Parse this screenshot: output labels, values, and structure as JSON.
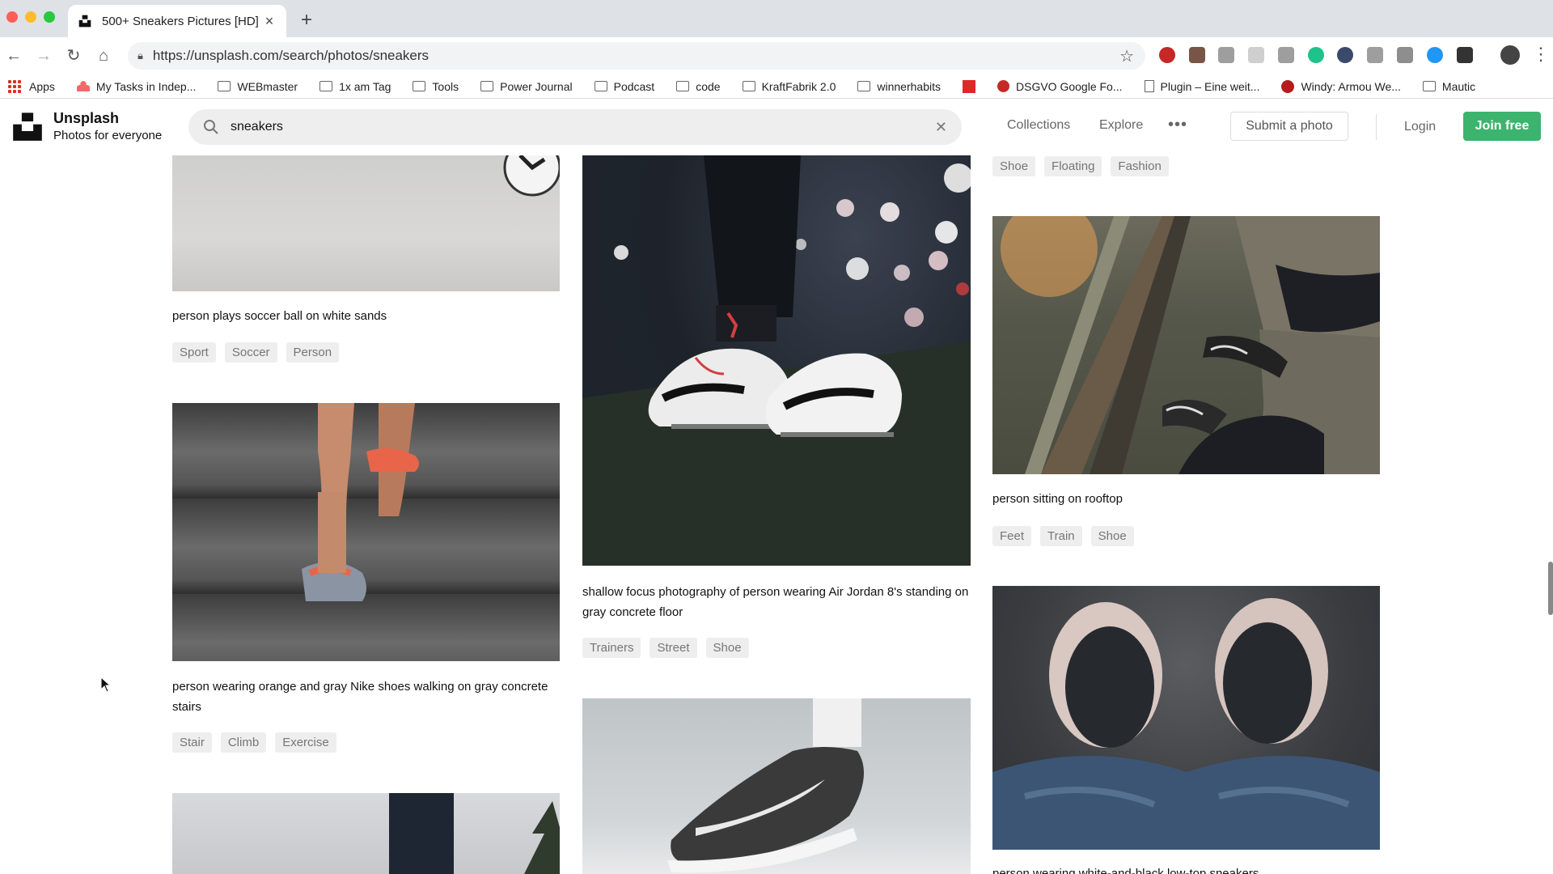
{
  "browser": {
    "tab_title": "500+ Sneakers Pictures [HD] |",
    "url": "https://unsplash.com/search/photos/sneakers",
    "bookmarks": [
      {
        "label": "Apps",
        "icon": "apps-grid-icon"
      },
      {
        "label": "My Tasks in Indep...",
        "icon": "asana-icon"
      },
      {
        "label": "WEBmaster",
        "icon": "folder-icon"
      },
      {
        "label": "1x am Tag",
        "icon": "folder-icon"
      },
      {
        "label": "Tools",
        "icon": "folder-icon"
      },
      {
        "label": "Power Journal",
        "icon": "folder-icon"
      },
      {
        "label": "Podcast",
        "icon": "folder-icon"
      },
      {
        "label": "code",
        "icon": "folder-icon"
      },
      {
        "label": "KraftFabrik 2.0",
        "icon": "folder-icon"
      },
      {
        "label": "winnerhabits",
        "icon": "folder-icon"
      },
      {
        "label": "",
        "icon": "flipboard-icon"
      },
      {
        "label": "DSGVO Google Fo...",
        "icon": "site-icon"
      },
      {
        "label": "Plugin – Eine weit...",
        "icon": "page-icon"
      },
      {
        "label": "Windy: Armou We...",
        "icon": "site-icon"
      },
      {
        "label": "Mautic",
        "icon": "folder-icon"
      }
    ]
  },
  "header": {
    "brand_name": "Unsplash",
    "brand_tagline": "Photos for everyone",
    "search_value": "sneakers",
    "nav": {
      "collections": "Collections",
      "explore": "Explore",
      "submit": "Submit a photo",
      "login": "Login",
      "join": "Join free"
    }
  },
  "colors": {
    "brand_green": "#3cb46e",
    "tag_bg": "#eeeeee",
    "tag_text": "#767676"
  },
  "columns": [
    {
      "items": [
        {
          "caption": "person plays soccer ball on white sands",
          "tags": [
            "Sport",
            "Soccer",
            "Person"
          ]
        },
        {
          "caption": "person wearing orange and gray Nike shoes walking on gray concrete stairs",
          "tags": [
            "Stair",
            "Climb",
            "Exercise"
          ]
        }
      ]
    },
    {
      "items": [
        {
          "caption": "shallow focus photography of person wearing Air Jordan 8's standing on gray concrete floor",
          "tags": [
            "Trainers",
            "Street",
            "Shoe"
          ]
        }
      ]
    },
    {
      "top_tags": [
        "Shoe",
        "Floating",
        "Fashion"
      ],
      "items": [
        {
          "caption": "person sitting on rooftop",
          "tags": [
            "Feet",
            "Train",
            "Shoe"
          ]
        },
        {
          "caption": "person wearing white-and-black low-top sneakers"
        }
      ]
    }
  ]
}
